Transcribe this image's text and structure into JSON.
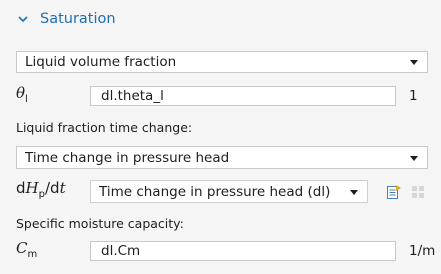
{
  "section": {
    "title": "Saturation",
    "icon": "chevron-down-icon"
  },
  "saturation_combo": {
    "value": "Liquid volume fraction"
  },
  "theta_row": {
    "symbol": "θ",
    "subscript": "l",
    "value": "dl.theta_l",
    "unit": "1"
  },
  "liquid_fraction_label": "Liquid fraction time change:",
  "time_change_combo": {
    "value": "Time change in pressure head"
  },
  "dhdt_row": {
    "symbol_main": "dH",
    "subscript": "p",
    "symbol_tail": "/dt",
    "combo_value": "Time change in pressure head (dl)",
    "go_to_source_icon": "go-to-source-icon",
    "create_variable_icon": "create-variable-icon"
  },
  "moisture_label": "Specific moisture capacity:",
  "cm_row": {
    "symbol": "C",
    "subscript": "m",
    "value": "dl.Cm",
    "unit": "1/m"
  },
  "colors": {
    "accent": "#1f6fb2",
    "background": "#f5f5f5",
    "field_border": "#c9c9c9"
  }
}
